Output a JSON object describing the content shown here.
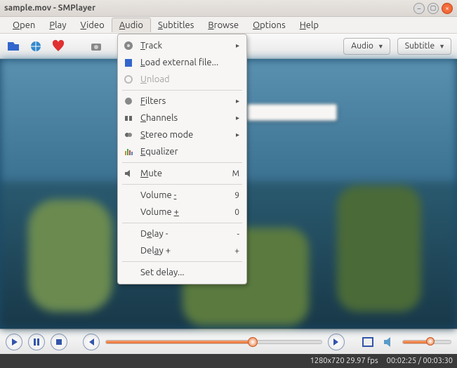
{
  "window": {
    "title": "sample.mov - SMPlayer"
  },
  "menubar": {
    "items": [
      {
        "label": "Open",
        "u": 0
      },
      {
        "label": "Play",
        "u": 0
      },
      {
        "label": "Video",
        "u": 0
      },
      {
        "label": "Audio",
        "u": 0,
        "open": true
      },
      {
        "label": "Subtitles",
        "u": 0
      },
      {
        "label": "Browse",
        "u": 0
      },
      {
        "label": "Options",
        "u": 0
      },
      {
        "label": "Help",
        "u": 0
      }
    ]
  },
  "toolbar": {
    "audio_btn": "Audio",
    "subtitle_btn": "Subtitle"
  },
  "audio_menu": {
    "track": "Track",
    "load_external": "Load external file...",
    "unload": "Unload",
    "filters": "Filters",
    "channels": "Channels",
    "stereo": "Stereo mode",
    "equalizer": "Equalizer",
    "mute": "Mute",
    "mute_accel": "M",
    "vol_minus": "Volume -",
    "vol_minus_accel": "9",
    "vol_plus": "Volume +",
    "vol_plus_accel": "0",
    "delay_minus": "Delay -",
    "delay_minus_accel": "-",
    "delay_plus": "Delay +",
    "delay_plus_accel": "+",
    "set_delay": "Set delay..."
  },
  "playback": {
    "seek_percent": 68,
    "volume_percent": 58
  },
  "status": {
    "resolution": "1280x720",
    "fps": "29.97 fps",
    "time_current": "00:02:25",
    "time_total": "00:03:30"
  },
  "colors": {
    "accent": "#e87030",
    "control_blue": "#3355aa"
  }
}
